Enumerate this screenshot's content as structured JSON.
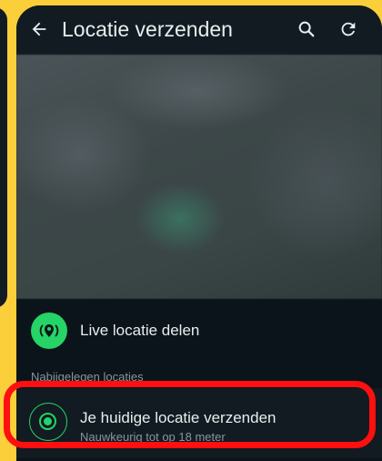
{
  "header": {
    "title": "Locatie verzenden",
    "back_icon": "arrow-left-icon",
    "search_icon": "search-icon",
    "refresh_icon": "refresh-icon"
  },
  "live_location": {
    "label": "Live locatie delen",
    "icon": "live-location-icon",
    "icon_color": "#25d366"
  },
  "nearby": {
    "section_label": "Nabijgelegen locaties"
  },
  "current_location": {
    "label": "Je huidige locatie verzenden",
    "accuracy": "Nauwkeurig tot op 18 meter",
    "icon": "current-location-icon",
    "icon_color": "#25d366"
  },
  "colors": {
    "background": "#0b141a",
    "accent": "#25d366",
    "highlight": "#ff0f0f",
    "outer_background": "#fbcf3a"
  }
}
